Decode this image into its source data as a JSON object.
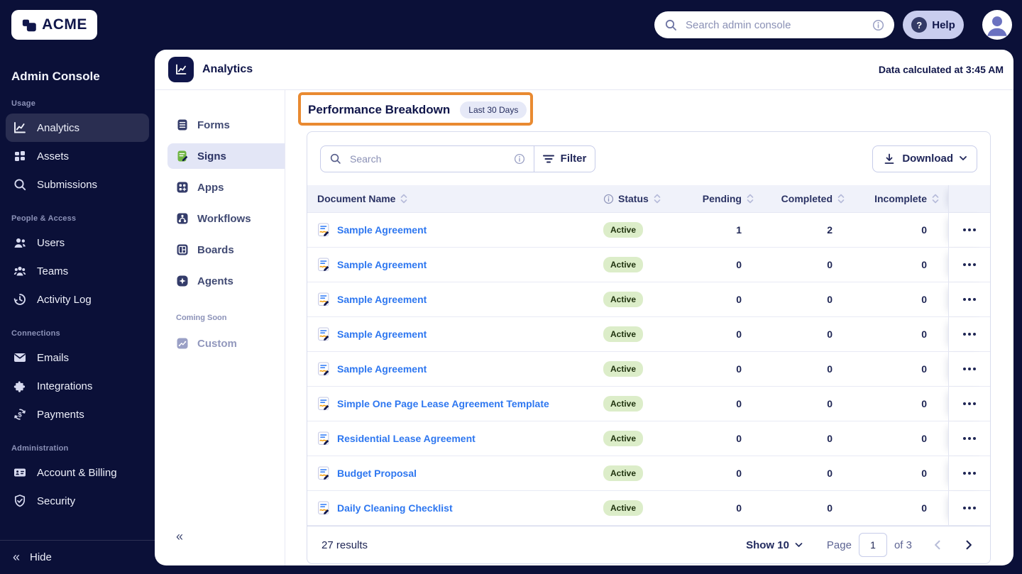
{
  "topbar": {
    "logo_text": "ACME",
    "search_placeholder": "Search admin console",
    "help_label": "Help"
  },
  "sidebar": {
    "title": "Admin Console",
    "sections": [
      {
        "label": "Usage",
        "items": [
          {
            "label": "Analytics"
          },
          {
            "label": "Assets"
          },
          {
            "label": "Submissions"
          }
        ]
      },
      {
        "label": "People & Access",
        "items": [
          {
            "label": "Users"
          },
          {
            "label": "Teams"
          },
          {
            "label": "Activity Log"
          }
        ]
      },
      {
        "label": "Connections",
        "items": [
          {
            "label": "Emails"
          },
          {
            "label": "Integrations"
          },
          {
            "label": "Payments"
          }
        ]
      },
      {
        "label": "Administration",
        "items": [
          {
            "label": "Account & Billing"
          },
          {
            "label": "Security"
          }
        ]
      }
    ],
    "hide_label": "Hide"
  },
  "panel": {
    "title": "Analytics",
    "data_note": "Data calculated at 3:45 AM"
  },
  "subnav": {
    "items": [
      {
        "label": "Forms"
      },
      {
        "label": "Signs",
        "active": true
      },
      {
        "label": "Apps"
      },
      {
        "label": "Workflows"
      },
      {
        "label": "Boards"
      },
      {
        "label": "Agents"
      }
    ],
    "coming_soon_label": "Coming Soon",
    "coming_items": [
      {
        "label": "Custom"
      }
    ]
  },
  "content": {
    "section_title": "Performance Breakdown",
    "period_badge": "Last 30 Days",
    "toolbar": {
      "search_placeholder": "Search",
      "filter_label": "Filter",
      "download_label": "Download"
    },
    "table": {
      "columns": [
        "Document Name",
        "Status",
        "Pending",
        "Completed",
        "Incomplete"
      ],
      "rows": [
        {
          "name": "Sample Agreement",
          "status": "Active",
          "pending": "1",
          "completed": "2",
          "incomplete": "0"
        },
        {
          "name": "Sample Agreement",
          "status": "Active",
          "pending": "0",
          "completed": "0",
          "incomplete": "0"
        },
        {
          "name": "Sample Agreement",
          "status": "Active",
          "pending": "0",
          "completed": "0",
          "incomplete": "0"
        },
        {
          "name": "Sample Agreement",
          "status": "Active",
          "pending": "0",
          "completed": "0",
          "incomplete": "0"
        },
        {
          "name": "Sample Agreement",
          "status": "Active",
          "pending": "0",
          "completed": "0",
          "incomplete": "0"
        },
        {
          "name": "Simple One Page Lease Agreement Template",
          "status": "Active",
          "pending": "0",
          "completed": "0",
          "incomplete": "0"
        },
        {
          "name": "Residential Lease Agreement",
          "status": "Active",
          "pending": "0",
          "completed": "0",
          "incomplete": "0"
        },
        {
          "name": "Budget Proposal",
          "status": "Active",
          "pending": "0",
          "completed": "0",
          "incomplete": "0"
        },
        {
          "name": "Daily Cleaning Checklist",
          "status": "Active",
          "pending": "0",
          "completed": "0",
          "incomplete": "0"
        }
      ]
    },
    "footer": {
      "results_text": "27 results",
      "show_label": "Show 10",
      "page_label": "Page",
      "page_value": "1",
      "of_label": "of 3"
    }
  },
  "colors": {
    "page_bg": "#0b1038",
    "brand_navy": "#10164a",
    "link_blue": "#2e77f0",
    "active_badge_bg": "#dcedc9",
    "annotation_orange": "#e98a31",
    "signs_green": "#6fb543",
    "header_row_bg": "#f0f2fa"
  }
}
